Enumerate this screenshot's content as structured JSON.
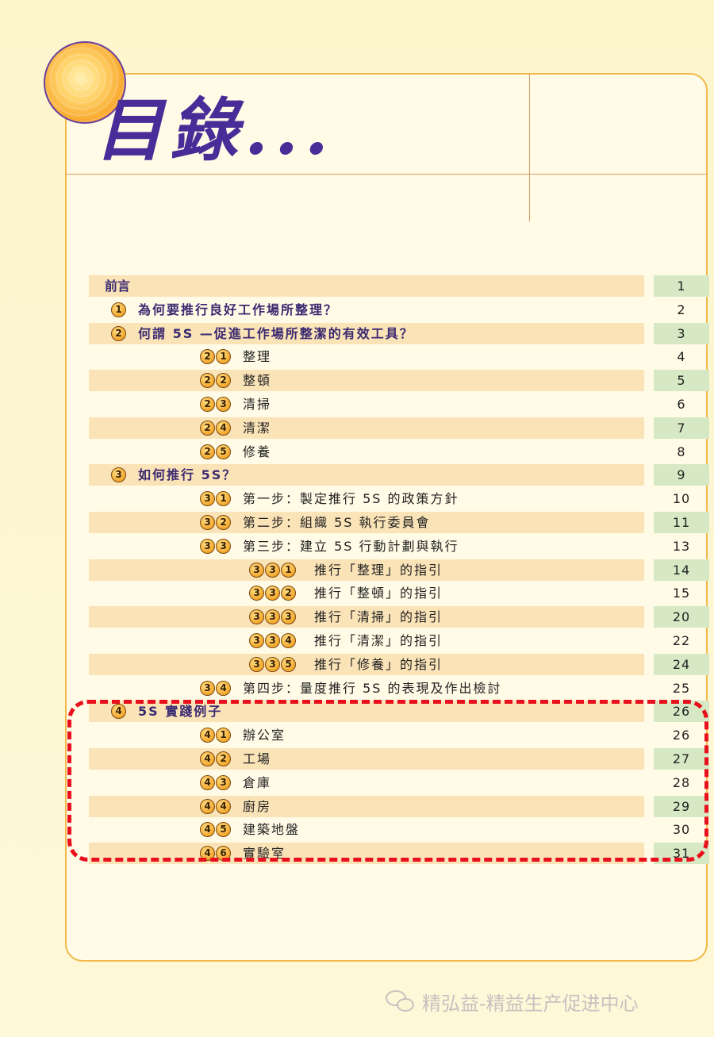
{
  "header": {
    "title": "目錄..."
  },
  "toc": [
    {
      "level": 0,
      "badges": [],
      "label": "前言",
      "page": "1",
      "shade": true
    },
    {
      "level": 1,
      "badges": [
        "1"
      ],
      "label": "為何要推行良好工作場所整理？",
      "page": "2",
      "shade": false
    },
    {
      "level": 1,
      "badges": [
        "2"
      ],
      "label": "何謂 5S —促進工作場所整潔的有效工具？",
      "page": "3",
      "shade": true
    },
    {
      "level": 2,
      "badges": [
        "2",
        "1"
      ],
      "label": "整理",
      "page": "4",
      "shade": false
    },
    {
      "level": 2,
      "badges": [
        "2",
        "2"
      ],
      "label": "整頓",
      "page": "5",
      "shade": true
    },
    {
      "level": 2,
      "badges": [
        "2",
        "3"
      ],
      "label": "清掃",
      "page": "6",
      "shade": false
    },
    {
      "level": 2,
      "badges": [
        "2",
        "4"
      ],
      "label": "清潔",
      "page": "7",
      "shade": true
    },
    {
      "level": 2,
      "badges": [
        "2",
        "5"
      ],
      "label": "修養",
      "page": "8",
      "shade": false
    },
    {
      "level": 1,
      "badges": [
        "3"
      ],
      "label": "如何推行 5S？",
      "page": "9",
      "shade": true
    },
    {
      "level": 2,
      "badges": [
        "3",
        "1"
      ],
      "label": "第一步：製定推行 5S 的政策方針",
      "page": "10",
      "shade": false
    },
    {
      "level": 2,
      "badges": [
        "3",
        "2"
      ],
      "label": "第二步：組織 5S 執行委員會",
      "page": "11",
      "shade": true
    },
    {
      "level": 2,
      "badges": [
        "3",
        "3"
      ],
      "label": "第三步：建立 5S 行動計劃與執行",
      "page": "13",
      "shade": false
    },
    {
      "level": 3,
      "badges": [
        "3",
        "3",
        "1"
      ],
      "label": "推行「整理」的指引",
      "page": "14",
      "shade": true
    },
    {
      "level": 3,
      "badges": [
        "3",
        "3",
        "2"
      ],
      "label": "推行「整頓」的指引",
      "page": "15",
      "shade": false
    },
    {
      "level": 3,
      "badges": [
        "3",
        "3",
        "3"
      ],
      "label": "推行「清掃」的指引",
      "page": "20",
      "shade": true
    },
    {
      "level": 3,
      "badges": [
        "3",
        "3",
        "4"
      ],
      "label": "推行「清潔」的指引",
      "page": "22",
      "shade": false
    },
    {
      "level": 3,
      "badges": [
        "3",
        "3",
        "5"
      ],
      "label": "推行「修養」的指引",
      "page": "24",
      "shade": true
    },
    {
      "level": 2,
      "badges": [
        "3",
        "4"
      ],
      "label": "第四步：量度推行 5S 的表現及作出檢討",
      "page": "25",
      "shade": false
    },
    {
      "level": 1,
      "badges": [
        "4"
      ],
      "label": "5S 實踐例子",
      "page": "26",
      "shade": true
    },
    {
      "level": 2,
      "badges": [
        "4",
        "1"
      ],
      "label": "辦公室",
      "page": "26",
      "shade": false
    },
    {
      "level": 2,
      "badges": [
        "4",
        "2"
      ],
      "label": "工場",
      "page": "27",
      "shade": true
    },
    {
      "level": 2,
      "badges": [
        "4",
        "3"
      ],
      "label": "倉庫",
      "page": "28",
      "shade": false
    },
    {
      "level": 2,
      "badges": [
        "4",
        "4"
      ],
      "label": "廚房",
      "page": "29",
      "shade": true
    },
    {
      "level": 2,
      "badges": [
        "4",
        "5"
      ],
      "label": "建築地盤",
      "page": "30",
      "shade": false
    },
    {
      "level": 2,
      "badges": [
        "4",
        "6"
      ],
      "label": "實驗室",
      "page": "31",
      "shade": true
    }
  ],
  "watermark": {
    "text": "精弘益-精益生产促进中心",
    "icon": "wechat-icon"
  },
  "colors": {
    "title": "#4a2c98",
    "frame": "#f2b94a",
    "row_shade": "#fbe3b8",
    "page_shade": "#d6e9c4",
    "highlight": "#e8101c"
  }
}
